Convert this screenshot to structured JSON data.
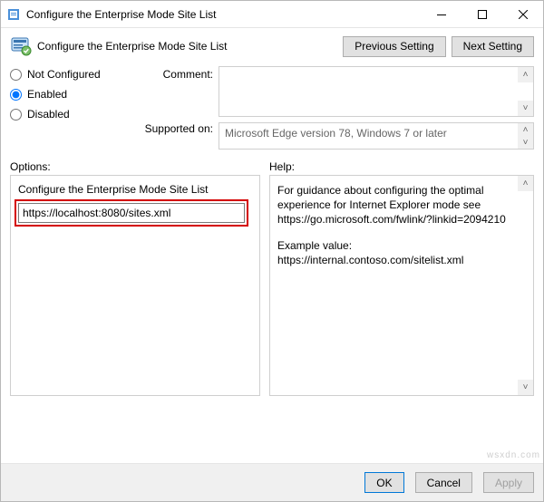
{
  "titlebar": {
    "title": "Configure the Enterprise Mode Site List"
  },
  "header": {
    "setting_name": "Configure the Enterprise Mode Site List",
    "prev_label": "Previous Setting",
    "next_label": "Next Setting"
  },
  "state": {
    "not_configured": "Not Configured",
    "enabled": "Enabled",
    "disabled": "Disabled",
    "selected": "enabled"
  },
  "meta": {
    "comment_label": "Comment:",
    "comment_value": "",
    "supported_label": "Supported on:",
    "supported_text": "Microsoft Edge version 78, Windows 7 or later"
  },
  "options": {
    "label": "Options:",
    "field_label": "Configure the Enterprise Mode Site List",
    "sitelist_value": "https://localhost:8080/sites.xml"
  },
  "help": {
    "label": "Help:",
    "p1": "For guidance about configuring the optimal experience for Internet Explorer mode see https://go.microsoft.com/fwlink/?linkid=2094210",
    "p2": "Example value: https://internal.contoso.com/sitelist.xml"
  },
  "footer": {
    "ok": "OK",
    "cancel": "Cancel",
    "apply": "Apply"
  },
  "watermark": "wsxdn.com"
}
